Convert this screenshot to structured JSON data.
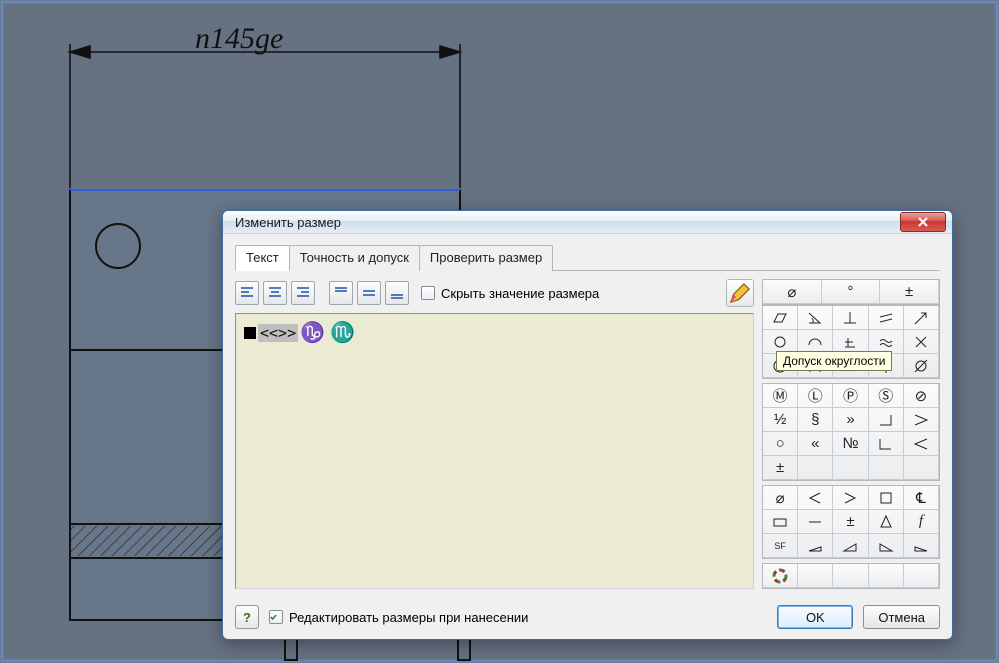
{
  "dimension": {
    "label": "n145ge"
  },
  "dialog": {
    "title": "Изменить размер",
    "tabs": [
      "Текст",
      "Точность и допуск",
      "Проверить размер"
    ],
    "active_tab": 0,
    "hide_dim_label": "Скрыть значение размера",
    "text_content": {
      "placeholder_token": "<<>>",
      "symbols": "♑ ♏"
    },
    "palette_tooltip": "Допуск округлости",
    "edit_on_place_label": "Редактировать размеры при нанесении",
    "edit_on_place_checked": true,
    "ok_label": "OK",
    "cancel_label": "Отмена",
    "help_label": "?"
  },
  "palette": {
    "top3": [
      "diameter",
      "degree",
      "plusminus"
    ],
    "geom": [
      "parallelogram",
      "angle",
      "perp",
      "equals-slant",
      "arrow-ne",
      "circle-sym",
      "half-arc",
      "perp2",
      "approx",
      "x-mark",
      "concentric",
      "arc-bracket",
      "arc2",
      "balloon",
      "slash-o"
    ],
    "gdt": [
      "circled-M",
      "circled-L",
      "circled-P",
      "circled-S",
      "circled-slash",
      "half",
      "section",
      "dbl-angle",
      "angle-open",
      "tri-open",
      "circ-small",
      "dbl-lt",
      "numero",
      "angle-open2",
      "tri-open2",
      "pm-small",
      "",
      "",
      "",
      ""
    ],
    "bottom": [
      "slash-circle",
      "flag-left",
      "flag-right",
      "square",
      "cl-vert",
      "box-outline",
      "line",
      "pm2",
      "cone",
      "f-script",
      "sf-box",
      "slope1",
      "slope2",
      "slope3",
      "slope4"
    ],
    "last": [
      "color-wheel"
    ]
  }
}
